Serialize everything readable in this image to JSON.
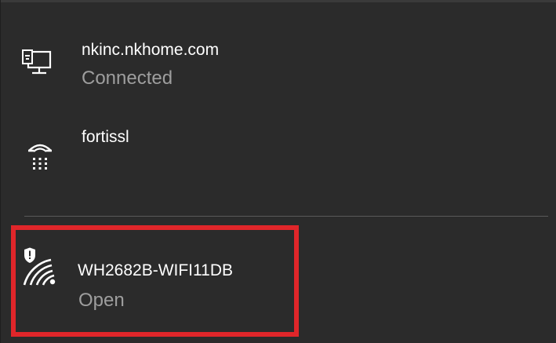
{
  "networks": [
    {
      "name": "nkinc.nkhome.com",
      "status": "Connected",
      "icon": "ethernet-computer-icon"
    },
    {
      "name": "fortissl",
      "status": "",
      "icon": "dialup-phone-icon"
    },
    {
      "name": "WH2682B-WIFI11DB",
      "status": "Open",
      "icon": "wifi-unsecured-shield-icon"
    }
  ],
  "colors": {
    "background": "#2b2b2b",
    "primary_text": "#ffffff",
    "secondary_text": "#9e9e9e",
    "divider": "#5a5a5a",
    "highlight": "#e0262a"
  }
}
